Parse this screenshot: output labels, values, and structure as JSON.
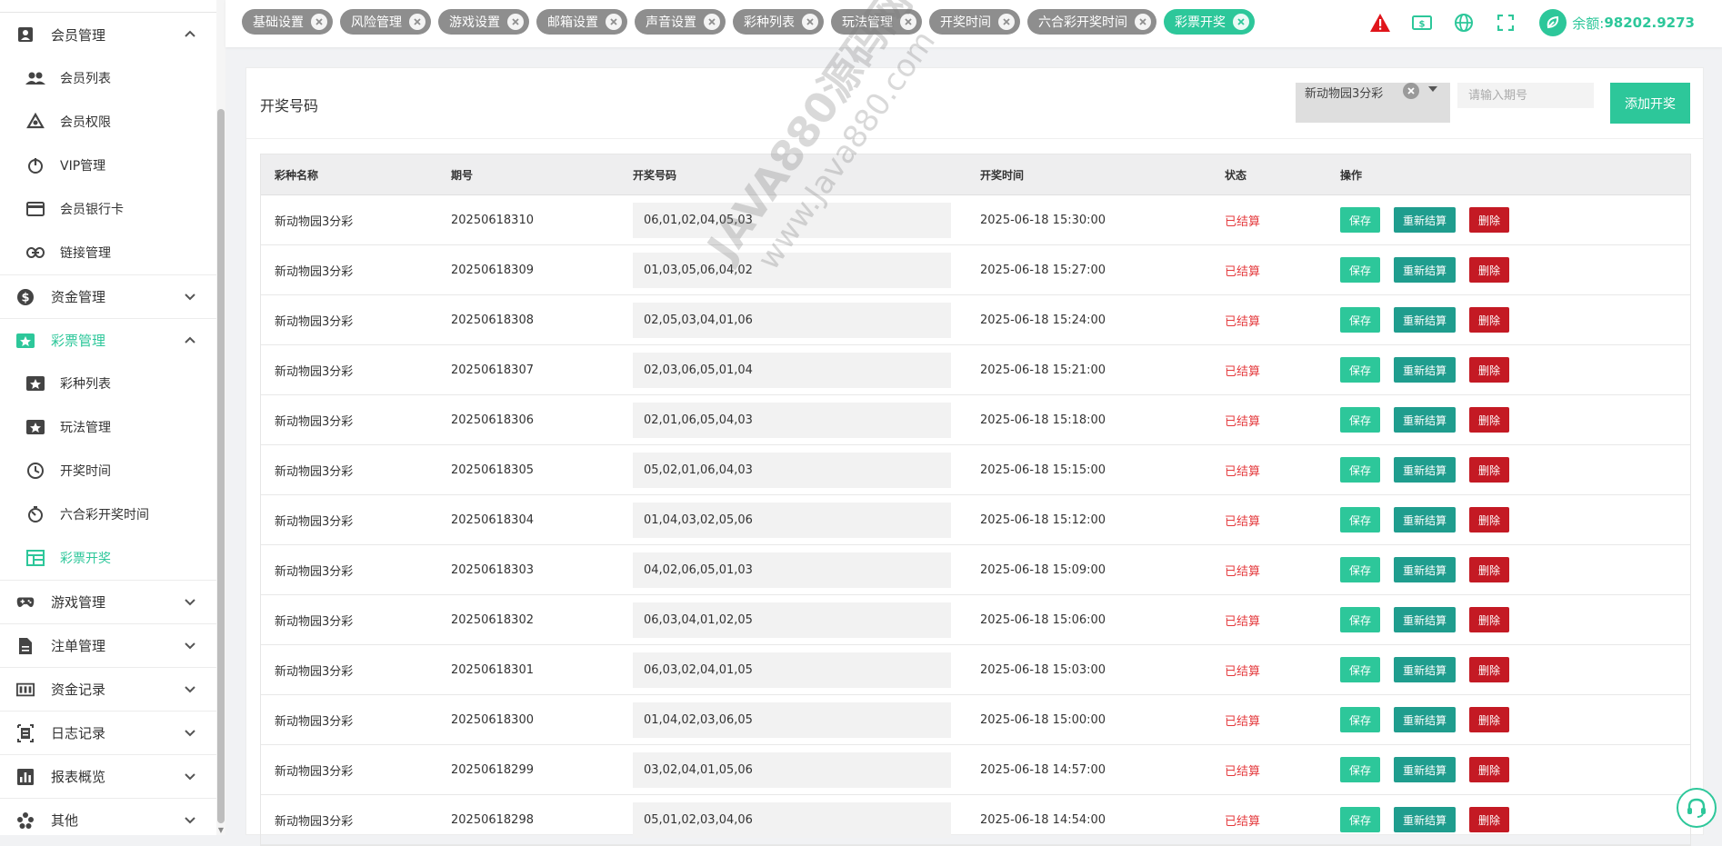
{
  "sidebar": {
    "groups": [
      {
        "label": "会员管理",
        "icon": "user-badge-icon",
        "expanded": true
      },
      {
        "label": "资金管理",
        "icon": "dollar-icon",
        "expanded": false
      },
      {
        "label": "彩票管理",
        "icon": "ticket-star-icon",
        "expanded": true
      },
      {
        "label": "游戏管理",
        "icon": "gamepad-icon",
        "expanded": false
      },
      {
        "label": "注单管理",
        "icon": "document-icon",
        "expanded": false
      },
      {
        "label": "资金记录",
        "icon": "counter-icon",
        "expanded": false
      },
      {
        "label": "日志记录",
        "icon": "log-icon",
        "expanded": false
      },
      {
        "label": "报表概览",
        "icon": "bar-chart-icon",
        "expanded": false
      },
      {
        "label": "其他",
        "icon": "cluster-icon",
        "expanded": false
      }
    ],
    "member_items": [
      "会员列表",
      "会员权限",
      "VIP管理",
      "会员银行卡",
      "链接管理"
    ],
    "lottery_items": [
      "彩种列表",
      "玩法管理",
      "开奖时间",
      "六合彩开奖时间",
      "彩票开奖"
    ]
  },
  "tabs": [
    {
      "label": "基础设置",
      "active": false
    },
    {
      "label": "风险管理",
      "active": false
    },
    {
      "label": "游戏设置",
      "active": false
    },
    {
      "label": "邮箱设置",
      "active": false
    },
    {
      "label": "声音设置",
      "active": false
    },
    {
      "label": "彩种列表",
      "active": false
    },
    {
      "label": "玩法管理",
      "active": false
    },
    {
      "label": "开奖时间",
      "active": false
    },
    {
      "label": "六合彩开奖时间",
      "active": false
    },
    {
      "label": "彩票开奖",
      "active": true
    }
  ],
  "header": {
    "balance_label": "余额:",
    "balance_value": "98202.9273"
  },
  "page": {
    "title": "开奖号码",
    "select_value": "新动物园3分彩",
    "period_placeholder": "请输入期号",
    "add_button": "添加开奖"
  },
  "table": {
    "columns": [
      "彩种名称",
      "期号",
      "开奖号码",
      "开奖时间",
      "状态",
      "操作"
    ],
    "actions": {
      "save": "保存",
      "resettle": "重新结算",
      "delete": "删除"
    },
    "rows": [
      {
        "name": "新动物园3分彩",
        "issue": "20250618310",
        "numbers": "06,01,02,04,05,03",
        "time": "2025-06-18 15:30:00",
        "status": "已结算"
      },
      {
        "name": "新动物园3分彩",
        "issue": "20250618309",
        "numbers": "01,03,05,06,04,02",
        "time": "2025-06-18 15:27:00",
        "status": "已结算"
      },
      {
        "name": "新动物园3分彩",
        "issue": "20250618308",
        "numbers": "02,05,03,04,01,06",
        "time": "2025-06-18 15:24:00",
        "status": "已结算"
      },
      {
        "name": "新动物园3分彩",
        "issue": "20250618307",
        "numbers": "02,03,06,05,01,04",
        "time": "2025-06-18 15:21:00",
        "status": "已结算"
      },
      {
        "name": "新动物园3分彩",
        "issue": "20250618306",
        "numbers": "02,01,06,05,04,03",
        "time": "2025-06-18 15:18:00",
        "status": "已结算"
      },
      {
        "name": "新动物园3分彩",
        "issue": "20250618305",
        "numbers": "05,02,01,06,04,03",
        "time": "2025-06-18 15:15:00",
        "status": "已结算"
      },
      {
        "name": "新动物园3分彩",
        "issue": "20250618304",
        "numbers": "01,04,03,02,05,06",
        "time": "2025-06-18 15:12:00",
        "status": "已结算"
      },
      {
        "name": "新动物园3分彩",
        "issue": "20250618303",
        "numbers": "04,02,06,05,01,03",
        "time": "2025-06-18 15:09:00",
        "status": "已结算"
      },
      {
        "name": "新动物园3分彩",
        "issue": "20250618302",
        "numbers": "06,03,04,01,02,05",
        "time": "2025-06-18 15:06:00",
        "status": "已结算"
      },
      {
        "name": "新动物园3分彩",
        "issue": "20250618301",
        "numbers": "06,03,02,04,01,05",
        "time": "2025-06-18 15:03:00",
        "status": "已结算"
      },
      {
        "name": "新动物园3分彩",
        "issue": "20250618300",
        "numbers": "01,04,02,03,06,05",
        "time": "2025-06-18 15:00:00",
        "status": "已结算"
      },
      {
        "name": "新动物园3分彩",
        "issue": "20250618299",
        "numbers": "03,02,04,01,05,06",
        "time": "2025-06-18 14:57:00",
        "status": "已结算"
      },
      {
        "name": "新动物园3分彩",
        "issue": "20250618298",
        "numbers": "05,01,02,03,04,06",
        "time": "2025-06-18 14:54:00",
        "status": "已结算"
      }
    ]
  },
  "watermark": {
    "line1": "JAVA880源码网",
    "line2": "www.Java880.com"
  },
  "colors": {
    "accent": "#2dc79a",
    "teal_dark": "#1f9d8e",
    "danger": "#c41a24",
    "status_red": "#e4393c",
    "tab_gray": "#8e8e8e"
  }
}
